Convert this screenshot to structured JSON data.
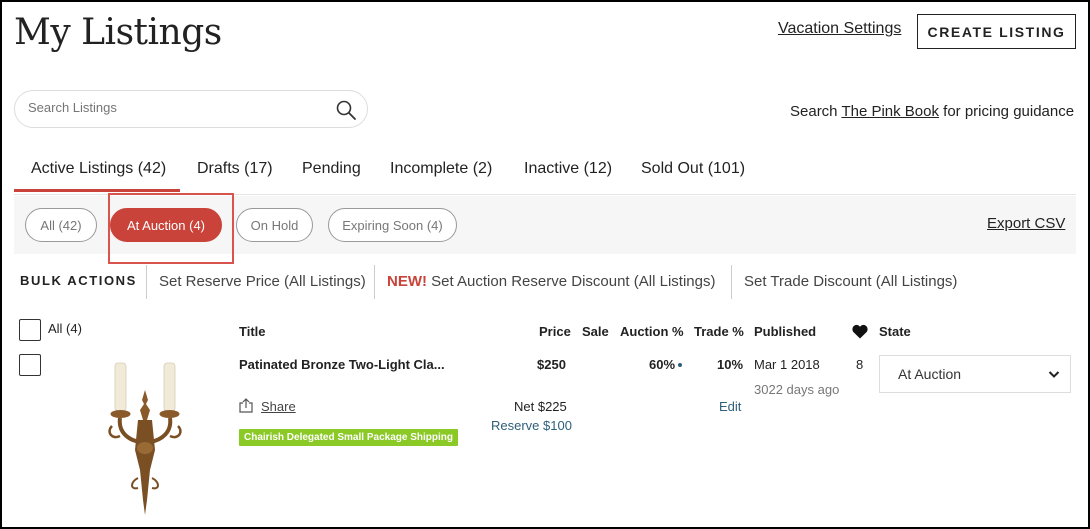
{
  "header": {
    "title": "My Listings",
    "vacation_link": "Vacation Settings",
    "create_button": "CREATE LISTING"
  },
  "search": {
    "placeholder": "Search Listings",
    "guidance_prefix": "Search ",
    "guidance_link": "The Pink Book",
    "guidance_suffix": " for pricing guidance"
  },
  "tabs": [
    {
      "label": "Active Listings (42)",
      "active": true
    },
    {
      "label": "Drafts (17)"
    },
    {
      "label": "Pending"
    },
    {
      "label": "Incomplete (2)"
    },
    {
      "label": "Inactive (12)"
    },
    {
      "label": "Sold Out (101)"
    }
  ],
  "filters": [
    {
      "label": "All (42)"
    },
    {
      "label": "At Auction (4)",
      "active": true
    },
    {
      "label": "On Hold"
    },
    {
      "label": "Expiring Soon (4)"
    }
  ],
  "export_label": "Export CSV",
  "bulk": {
    "label": "BULK ACTIONS",
    "set_reserve": "Set Reserve Price (All Listings)",
    "new_tag": "NEW!",
    "set_auction_discount": " Set Auction Reserve Discount (All Listings)",
    "set_trade_discount": "Set Trade Discount (All Listings)"
  },
  "table": {
    "all_label": "All (4)",
    "headers": {
      "title": "Title",
      "price": "Price",
      "sale": "Sale",
      "auction": "Auction %",
      "trade": "Trade %",
      "published": "Published",
      "state": "State"
    },
    "rows": [
      {
        "title": "Patinated Bronze Two-Light Cla...",
        "price": "$250",
        "auction_pct": "60%",
        "trade_pct": "10%",
        "published": "Mar 1 2018",
        "published_ago": "3022 days ago",
        "favorites": "8",
        "state": "At Auction",
        "share": "Share",
        "net": "Net $225",
        "reserve": "Reserve $100",
        "edit": "Edit",
        "shipping_badge": "Chairish Delegated Small Package Shipping"
      }
    ]
  },
  "colors": {
    "accent": "#c9433a",
    "badge": "#8ac926"
  }
}
